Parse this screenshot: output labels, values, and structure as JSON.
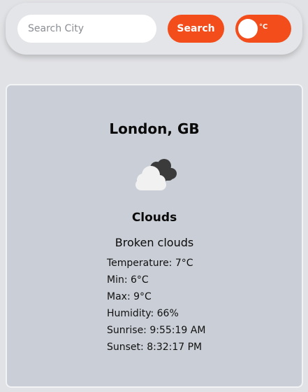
{
  "search": {
    "placeholder": "Search City",
    "value": "",
    "button_label": "Search"
  },
  "unit_toggle": {
    "label": "°C",
    "state": "celsius"
  },
  "weather": {
    "location": "London, GB",
    "icon": "broken-clouds-icon",
    "condition": "Clouds",
    "description": "Broken clouds",
    "details": [
      {
        "label": "Temperature",
        "value": "7°C",
        "text": "Temperature: 7°C"
      },
      {
        "label": "Min",
        "value": "6°C",
        "text": "Min: 6°C"
      },
      {
        "label": "Max",
        "value": "9°C",
        "text": "Max: 9°C"
      },
      {
        "label": "Humidity",
        "value": "66%",
        "text": "Humidity: 66%"
      },
      {
        "label": "Sunrise",
        "value": "9:55:19 AM",
        "text": "Sunrise: 9:55:19 AM"
      },
      {
        "label": "Sunset",
        "value": "8:32:17 PM",
        "text": "Sunset: 8:32:17 PM"
      }
    ]
  },
  "colors": {
    "accent": "#f24d1b",
    "page_background": "#e1e2e5",
    "card_background": "#caced6"
  }
}
